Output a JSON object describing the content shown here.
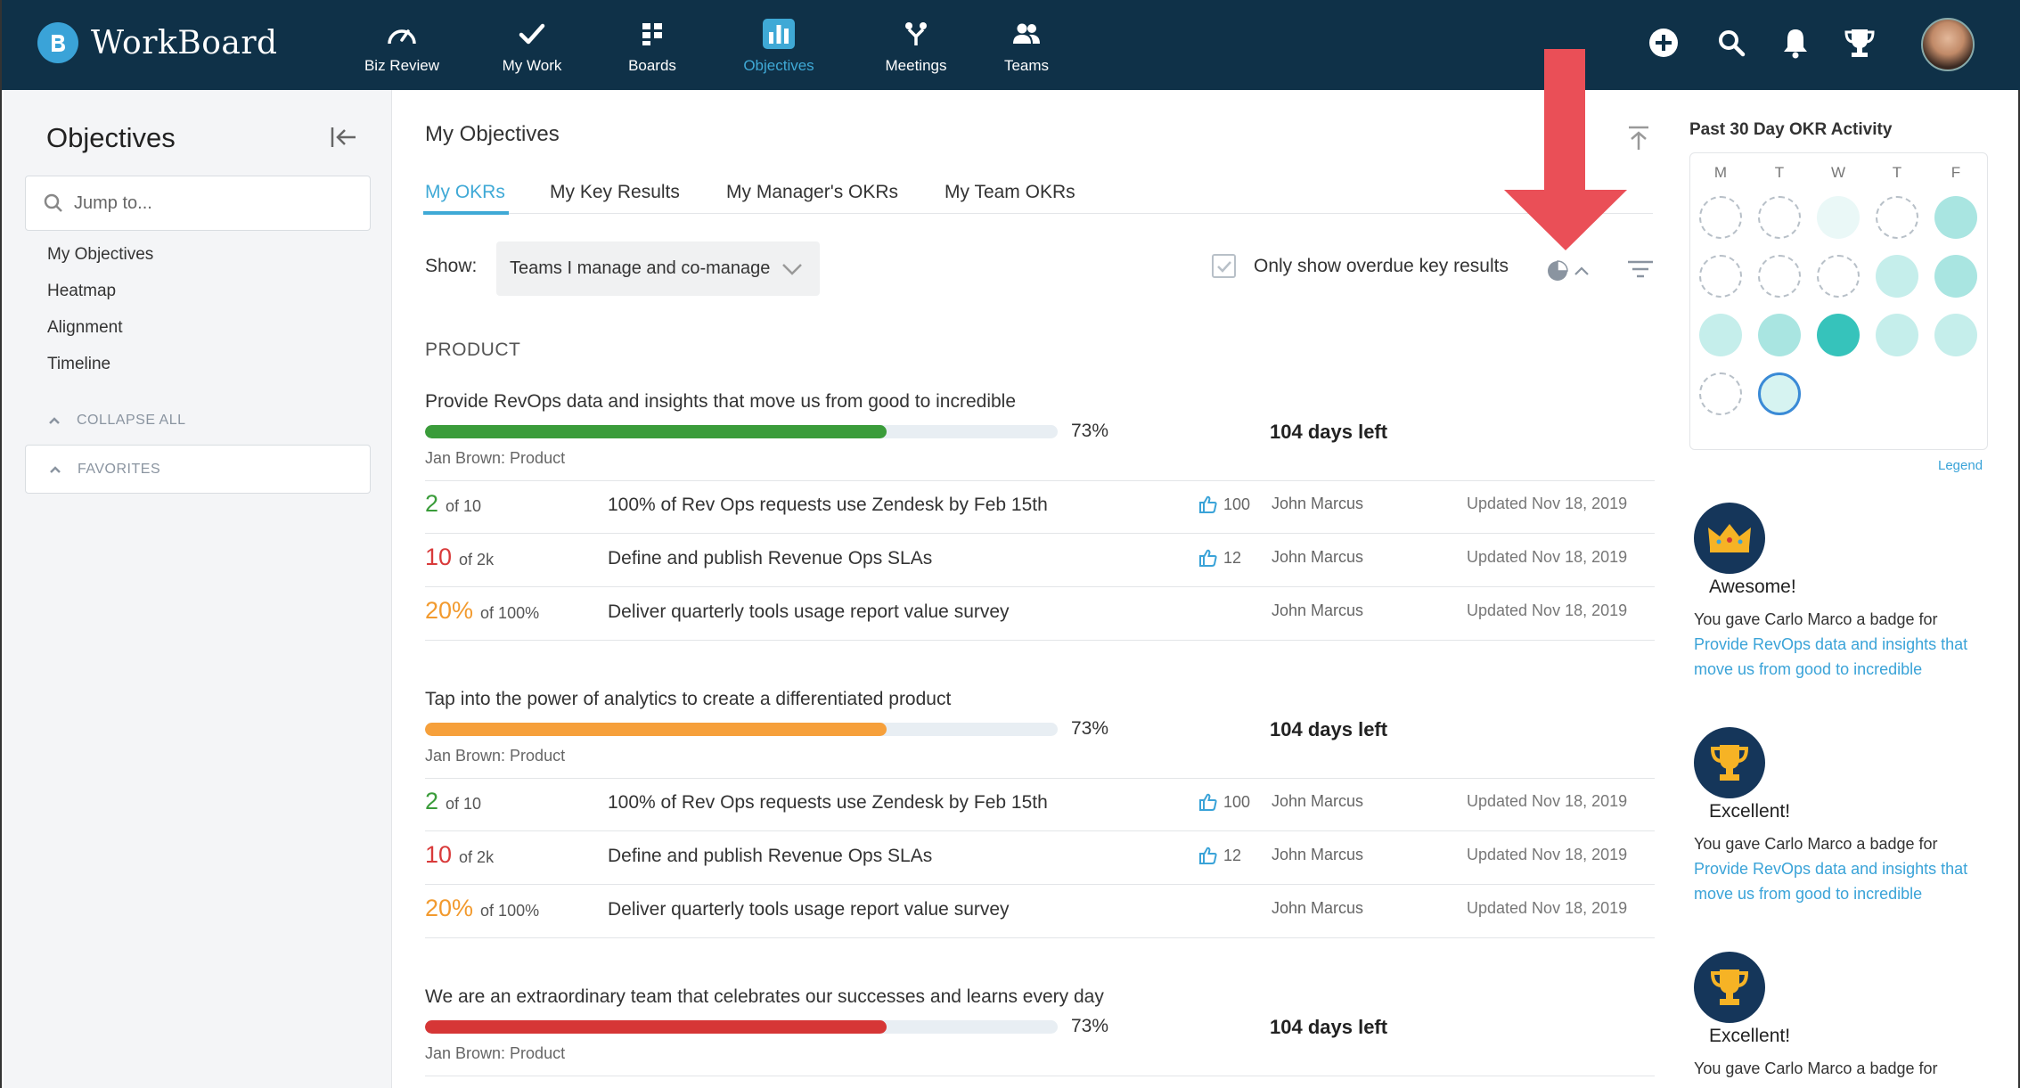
{
  "app": {
    "name": "WorkBoard"
  },
  "nav": [
    {
      "label": "Biz Review",
      "icon": "speedometer-icon"
    },
    {
      "label": "My Work",
      "icon": "checkmark-icon"
    },
    {
      "label": "Boards",
      "icon": "boards-icon"
    },
    {
      "label": "Objectives",
      "icon": "bar-chart-icon",
      "active": true
    },
    {
      "label": "Meetings",
      "icon": "meetings-icon"
    },
    {
      "label": "Teams",
      "icon": "teams-icon"
    }
  ],
  "top_actions": [
    "add-icon",
    "search-icon",
    "bell-icon",
    "trophy-icon",
    "avatar"
  ],
  "sidebar": {
    "title": "Objectives",
    "search_placeholder": "Jump to...",
    "links": [
      "My Objectives",
      "Heatmap",
      "Alignment",
      "Timeline"
    ],
    "collapse_all": "COLLAPSE ALL",
    "favorites": "FAVORITES"
  },
  "main": {
    "title": "My Objectives",
    "tabs": [
      "My OKRs",
      "My Key Results",
      "My Manager's OKRs",
      "My Team OKRs"
    ],
    "active_tab": "My OKRs",
    "show_label": "Show:",
    "show_value": "Teams I manage and co-manage",
    "overdue_label": "Only show overdue key results",
    "group": "PRODUCT",
    "objectives": [
      {
        "title": "Provide RevOps data and insights that move us from good to incredible",
        "progress": 73,
        "progress_label": "73%",
        "color": "#3a9c3a",
        "days_left": "104 days left",
        "owner": "Jan Brown: Product",
        "key_results": [
          {
            "value": "2",
            "of": "of 10",
            "color": "#3a9c3a",
            "title": "100% of Rev Ops requests use Zendesk by Feb 15th",
            "likes": "100",
            "owner": "John Marcus",
            "updated": "Updated Nov 18, 2019"
          },
          {
            "value": "10",
            "of": "of 2k",
            "color": "#d93a3a",
            "title": "Define and publish Revenue Ops SLAs",
            "likes": "12",
            "owner": "John Marcus",
            "updated": "Updated Nov 18, 2019"
          },
          {
            "value": "20%",
            "of": "of 100%",
            "color": "#f29a2e",
            "title": "Deliver quarterly tools usage report value survey",
            "likes": "",
            "owner": "John Marcus",
            "updated": "Updated Nov 18, 2019"
          }
        ]
      },
      {
        "title": "Tap into the power of analytics to create a differentiated product",
        "progress": 73,
        "progress_label": "73%",
        "color": "#f6a03b",
        "days_left": "104 days left",
        "owner": "Jan Brown: Product",
        "key_results": [
          {
            "value": "2",
            "of": "of 10",
            "color": "#3a9c3a",
            "title": "100% of Rev Ops requests use Zendesk by Feb 15th",
            "likes": "100",
            "owner": "John Marcus",
            "updated": "Updated Nov 18, 2019"
          },
          {
            "value": "10",
            "of": "of 2k",
            "color": "#d93a3a",
            "title": "Define and publish Revenue Ops SLAs",
            "likes": "12",
            "owner": "John Marcus",
            "updated": "Updated Nov 18, 2019"
          },
          {
            "value": "20%",
            "of": "of 100%",
            "color": "#f29a2e",
            "title": "Deliver quarterly tools usage report value survey",
            "likes": "",
            "owner": "John Marcus",
            "updated": "Updated Nov 18, 2019"
          }
        ]
      },
      {
        "title": "We are an extraordinary team that celebrates our successes and learns every day",
        "progress": 73,
        "progress_label": "73%",
        "color": "#d63636",
        "days_left": "104 days left",
        "owner": "Jan Brown: Product",
        "key_results": []
      }
    ]
  },
  "activity": {
    "title": "Past 30 Day OKR Activity",
    "days": [
      "M",
      "T",
      "W",
      "T",
      "F"
    ],
    "cells": [
      "empty",
      "empty",
      "faint",
      "empty",
      "mid",
      "empty",
      "empty",
      "empty",
      "light",
      "mid",
      "light",
      "mid",
      "dark",
      "light",
      "light",
      "empty",
      "today"
    ],
    "legend": "Legend"
  },
  "badges": [
    {
      "icon": "crown-icon",
      "title": "Awesome!",
      "text": "You gave Carlo Marco a badge for",
      "link": "Provide RevOps data and insights that move us from good to incredible"
    },
    {
      "icon": "trophy-icon",
      "title": "Excellent!",
      "text": "You gave Carlo Marco a badge for",
      "link": "Provide RevOps data and insights that move us from good to incredible"
    },
    {
      "icon": "trophy-icon",
      "title": "Excellent!",
      "text": "You gave Carlo Marco a badge for",
      "link": ""
    }
  ],
  "colors": {
    "topbar": "#0f3148",
    "accent": "#3fa9d6",
    "arrow": "#ea4f57"
  }
}
